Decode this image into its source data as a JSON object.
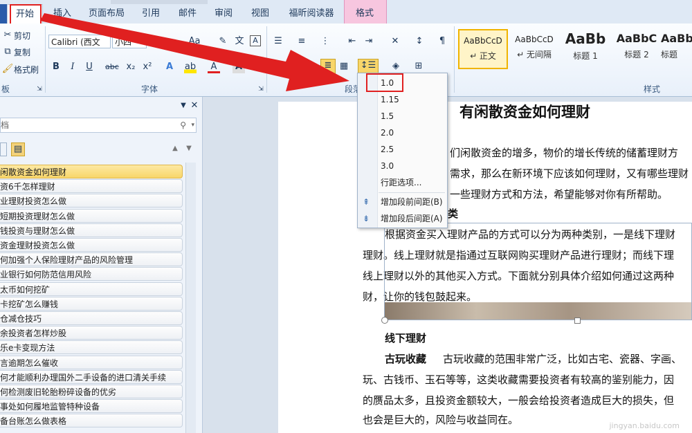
{
  "tabs": {
    "items": [
      "开始",
      "插入",
      "页面布局",
      "引用",
      "邮件",
      "审阅",
      "视图",
      "福昕阅读器"
    ],
    "context_tab": "格式"
  },
  "ribbon": {
    "clipboard": {
      "cut": "剪切",
      "copy": "复制",
      "format_painter": "格式刷",
      "group_label": "板"
    },
    "font": {
      "font_name": "Calibri (西文",
      "font_size": "小四",
      "group_label": "字体"
    },
    "paragraph": {
      "group_label": "段落"
    },
    "styles": {
      "group_label": "样式",
      "items": [
        {
          "sample": "AaBbCcD",
          "name": "↵ 正文"
        },
        {
          "sample": "AaBbCcD",
          "name": "↵ 无间隔"
        },
        {
          "sample": "AaBb",
          "name": "标题 1"
        },
        {
          "sample": "AaBbC",
          "name": "标题 2"
        },
        {
          "sample": "AaBb",
          "name": "标题"
        }
      ]
    }
  },
  "line_spacing_menu": {
    "options": [
      "1.0",
      "1.15",
      "1.5",
      "2.0",
      "2.5",
      "3.0"
    ],
    "selected": "1.0",
    "line_options": "行距选项...",
    "add_before": "增加段前间距(B)",
    "add_after": "增加段后间距(A)"
  },
  "nav_pane": {
    "search_text": "档",
    "items": [
      "闲散资金如何理财",
      "资6千怎样理财",
      "业理财投资怎么做",
      "短期投资理财怎么做",
      "钱投资与理财怎么做",
      "资金理财投资怎么做",
      "何加强个人保险理财产品的风险管理",
      "业银行如何防范信用风险",
      "太币如何挖矿",
      "卡挖矿怎么赚钱",
      "仓减仓技巧",
      "余投资者怎样炒股",
      "乐e卡变现方法",
      "言逾期怎么催收",
      "何才能顺利办理国外二手设备的进口清关手续",
      "何检测废旧轮胎粉碎设备的优劣",
      "事处如何履地监管特种设备",
      "备台账怎么做表格"
    ],
    "selected_index": 0
  },
  "document": {
    "title": "有闲散资金如何理财",
    "para1_l1": "们闲散资金的增多，物价的增长传统的储蓄理财方",
    "para1_l2": "需求，那么在新环境下应该如何理财，又有哪些理财",
    "para1_l3": "一些理财方式和方法，希望能够对你有所帮助。",
    "heading_frag": "类",
    "para2_l1": "根据资金买入理财产品的方式可以分为两种类别，一是线下理财",
    "para2_l2": "理财。线上理财就是指通过互联网购买理财产品进行理财；而线下理",
    "para2_l3": "线上理财以外的其他买入方式。下面就分别具体介绍如何通过这两种",
    "para2_l4": "财，让你的钱包鼓起来。",
    "heading2": "线下理财",
    "para3_bold": "古玩收藏",
    "para3_l1": "古玩收藏的范围非常广泛，比如古宅、瓷器、字画、",
    "para3_l2": "玩、古钱币、玉石等等，这类收藏需要投资者有较高的鉴别能力，因",
    "para3_l3": "的赝品太多，且投资金额较大，一般会给投资者造成巨大的损失，但",
    "para3_l4": "也会是巨大的，风险与收益同在。"
  },
  "watermark": "jingyan.baidu.com",
  "colors": {
    "highlight_box": "#e02020",
    "arrow": "#e02020",
    "nav_selected": "#f8d66a",
    "context_tab": "#f7c6df"
  }
}
